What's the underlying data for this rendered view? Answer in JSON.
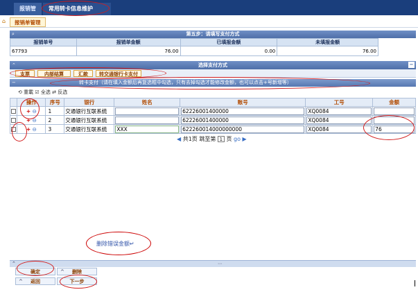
{
  "top_tabs": [
    "报销管理",
    "常用转卡信息维护"
  ],
  "sub_tab": "报销单管理",
  "step_title": "第五步：请填写支付方式",
  "summary": {
    "headers": [
      "报销单号",
      "报销单金额",
      "已填报金额",
      "未填报金额"
    ],
    "values": [
      "67793",
      "76.00",
      "0.00",
      "76.00"
    ]
  },
  "pay_section_title": "选择支付方式",
  "pay_buttons": [
    "支票",
    "内部结算",
    "汇款",
    "转交通银行卡支付"
  ],
  "transfer_header": "转卡支付（请在填入金额后再复选框中勾选，只有去掉勾选才能修改金额，也可以点击+号新增等）",
  "toolbar": {
    "refresh": "重載",
    "select_all": "全选",
    "invert": "反选"
  },
  "grid": {
    "headers": [
      "操作",
      "序号",
      "银行",
      "姓名",
      "账号",
      "工号",
      "金额"
    ],
    "rows": [
      {
        "seq": "1",
        "bank": "交通银行互联系统",
        "name": "",
        "account": "62226001400000",
        "emp_id": "XQ0084",
        "amount": ""
      },
      {
        "seq": "2",
        "bank": "交通银行互联系统",
        "name": "",
        "account": "62226001400000",
        "emp_id": "XQ0084",
        "amount": ""
      },
      {
        "seq": "3",
        "bank": "交通银行互联系统",
        "name": "XXX",
        "account": "622260014000000000",
        "emp_id": "XQ0084",
        "amount": "76"
      }
    ]
  },
  "pager": {
    "text1": "共1页 跳至第",
    "page": "1",
    "text2": "页",
    "go": "go"
  },
  "footer": {
    "confirm": "确定",
    "delete": "删除",
    "back": "返回",
    "next": "下一步"
  },
  "callout_text": "删除错误金额↵",
  "colors": {
    "header_blue": "#1a3e7c",
    "accent_orange": "#b14a00",
    "annotation_red": "#d21c1c"
  }
}
